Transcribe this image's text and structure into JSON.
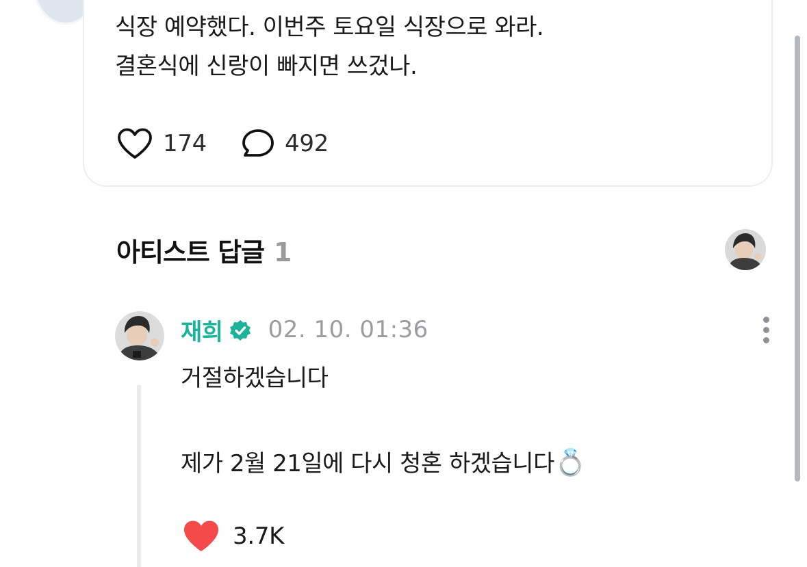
{
  "post": {
    "text_line1": "식장 예약했다. 이번주 토요일 식장으로 와라.",
    "text_line2": "결혼식에 신랑이 빠지면 쓰겄나.",
    "like_icon": "heart-outline-icon",
    "like_count": "174",
    "comment_icon": "speech-bubble-icon",
    "comment_count": "492"
  },
  "section": {
    "title": "아티스트 답글",
    "count": "1",
    "avatar_icon": "artist-avatar"
  },
  "reply": {
    "author": "재희",
    "verified_icon": "verified-badge-icon",
    "timestamp": "02. 10. 01:36",
    "line1": "거절하겠습니다",
    "line2": "제가 2월 21일에 다시 청혼 하겠습니다",
    "emoji": "💍",
    "like_icon": "heart-filled-icon",
    "like_count": "3.7K",
    "more_icon": "more-vertical-icon"
  },
  "colors": {
    "accent_teal": "#1cb39a",
    "heart_red": "#f44a4a",
    "muted_gray": "#9a9ca0",
    "scrollbar": "#b4b7bb"
  }
}
